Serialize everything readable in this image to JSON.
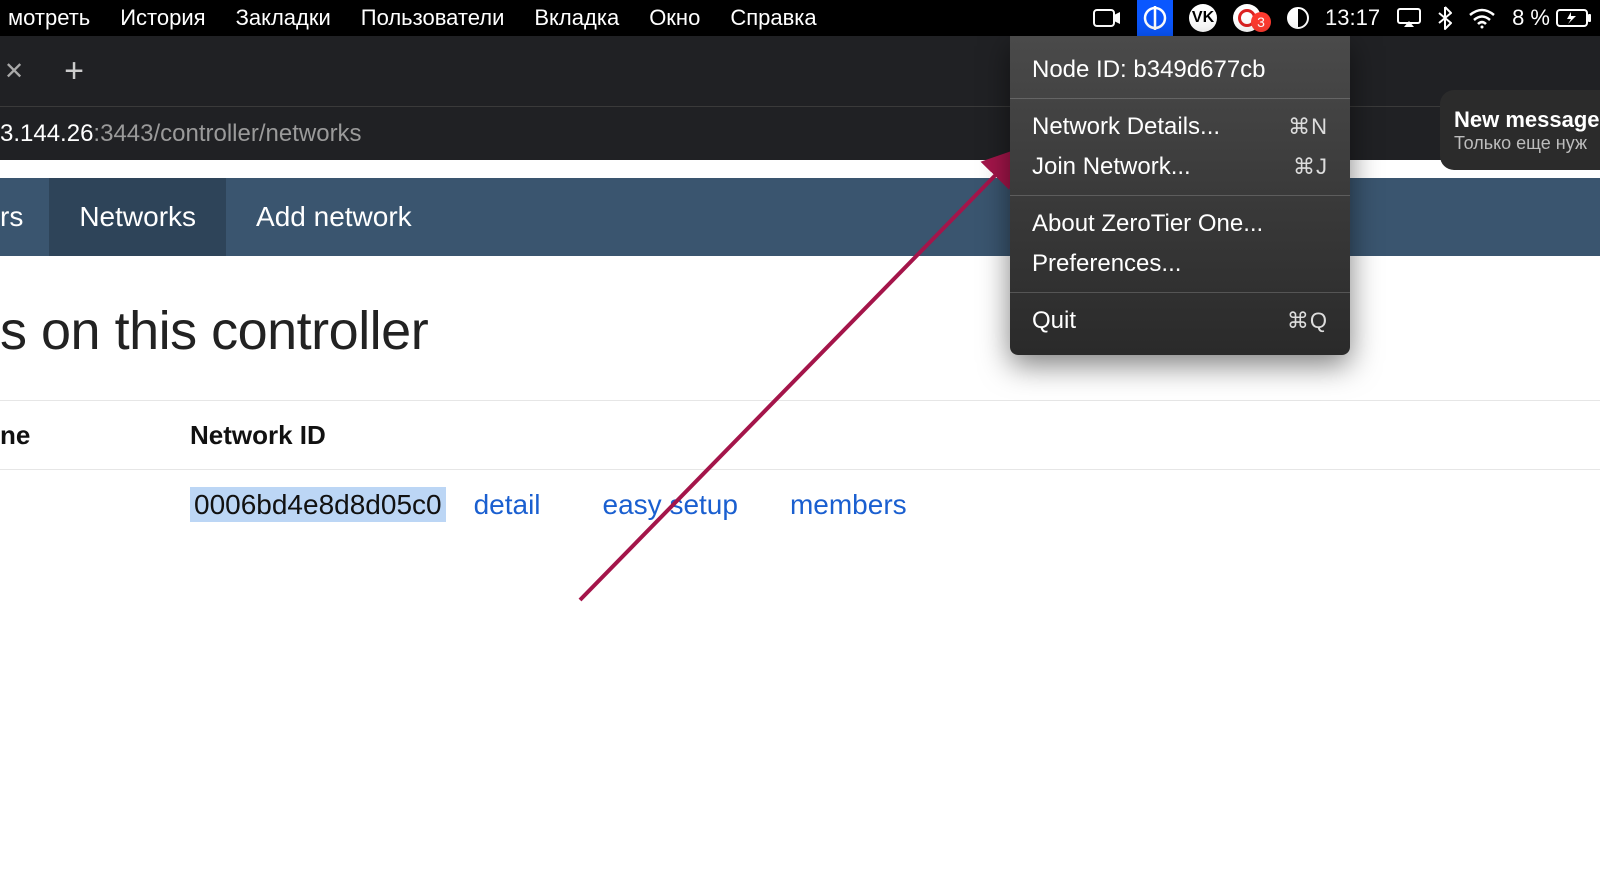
{
  "mac_menu": {
    "items": [
      "мотреть",
      "История",
      "Закладки",
      "Пользователи",
      "Вкладка",
      "Окно",
      "Справка"
    ]
  },
  "status_bar": {
    "notif_count": "3",
    "clock": "13:17",
    "battery_pct": "8 %"
  },
  "browser": {
    "address_host": "3.144.26",
    "address_path": ":3443/controller/networks"
  },
  "page_nav": {
    "partial_left": "rs",
    "active": "Networks",
    "add": "Add network"
  },
  "content": {
    "heading": "s on this controller",
    "table": {
      "name_header": "ne",
      "id_header": "Network ID",
      "rows": [
        {
          "id": "0006bd4e8d8d05c0",
          "links": {
            "detail": "detail",
            "easy": "easy setup",
            "members": "members"
          }
        }
      ]
    }
  },
  "zt_menu": {
    "node_id_label": "Node ID: b349d677cb",
    "network_details": "Network Details...",
    "join_network": "Join Network...",
    "about": "About ZeroTier One...",
    "preferences": "Preferences...",
    "quit": "Quit",
    "sc_details": "⌘N",
    "sc_join": "⌘J",
    "sc_quit": "⌘Q"
  },
  "notification": {
    "title": "New message",
    "subtitle": "Только еще нуж"
  },
  "icons": {
    "zoom": "◘",
    "zt": "⏀",
    "vk": "VK",
    "airplay": "⏏",
    "bt": "⌵",
    "wifi": "⌔",
    "charge": "⚡"
  }
}
